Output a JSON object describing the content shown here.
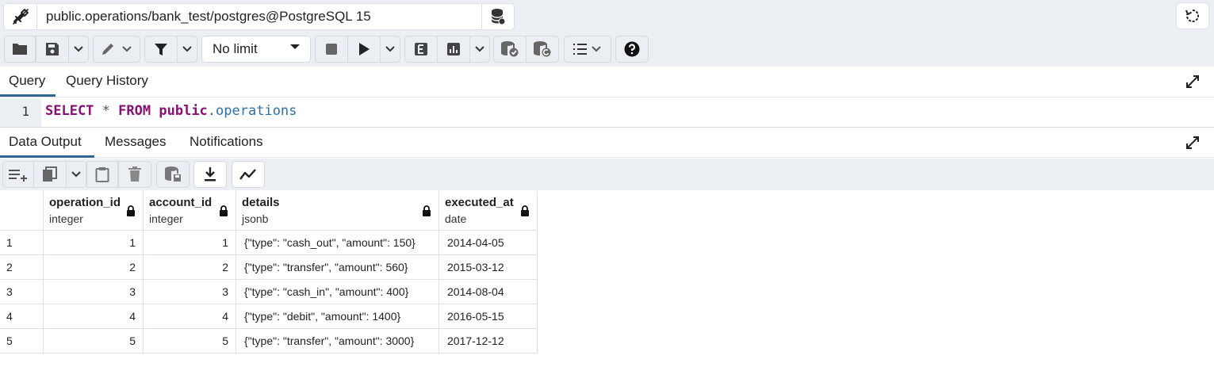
{
  "connection": {
    "title": "public.operations/bank_test/postgres@PostgreSQL 15"
  },
  "toolbar": {
    "limit_value": "No limit"
  },
  "query_tabs": [
    {
      "label": "Query",
      "active": true
    },
    {
      "label": "Query History",
      "active": false
    }
  ],
  "editor": {
    "line_number": "1",
    "tokens": {
      "select": "SELECT",
      "star": "*",
      "from": "FROM",
      "schema": "public",
      "dot": ".",
      "table": "operations"
    }
  },
  "result_tabs": [
    {
      "label": "Data Output",
      "active": true
    },
    {
      "label": "Messages",
      "active": false
    },
    {
      "label": "Notifications",
      "active": false
    }
  ],
  "columns": [
    {
      "name": "operation_id",
      "type": "integer"
    },
    {
      "name": "account_id",
      "type": "integer"
    },
    {
      "name": "details",
      "type": "jsonb"
    },
    {
      "name": "executed_at",
      "type": "date"
    }
  ],
  "rows": [
    {
      "n": "1",
      "cells": [
        "1",
        "1",
        "{\"type\": \"cash_out\", \"amount\": 150}",
        "2014-04-05"
      ]
    },
    {
      "n": "2",
      "cells": [
        "2",
        "2",
        "{\"type\": \"transfer\", \"amount\": 560}",
        "2015-03-12"
      ]
    },
    {
      "n": "3",
      "cells": [
        "3",
        "3",
        "{\"type\": \"cash_in\", \"amount\": 400}",
        "2014-08-04"
      ]
    },
    {
      "n": "4",
      "cells": [
        "4",
        "4",
        "{\"type\": \"debit\", \"amount\": 1400}",
        "2016-05-15"
      ]
    },
    {
      "n": "5",
      "cells": [
        "5",
        "5",
        "{\"type\": \"transfer\", \"amount\": 3000}",
        "2017-12-12"
      ]
    }
  ],
  "icons": {
    "connection_status": "plug-disconnected-icon",
    "database": "database-icon",
    "refresh": "refresh-icon",
    "open_file": "folder-icon",
    "save": "save-icon",
    "edit": "pencil-icon",
    "filter": "filter-icon",
    "stop": "stop-icon",
    "execute": "play-icon",
    "explain": "explain-icon",
    "explain_analyze": "chart-icon",
    "commit": "commit-icon",
    "rollback": "rollback-icon",
    "macros": "list-icon",
    "help": "help-icon",
    "expand": "expand-icon",
    "add_row": "add-row-icon",
    "copy": "copy-icon",
    "paste": "paste-icon",
    "delete": "trash-icon",
    "save_data": "save-data-icon",
    "download": "download-icon",
    "graph": "graph-icon",
    "lock": "lock-icon"
  },
  "colors": {
    "toolbar_bg": "#ebeef3",
    "active_tab": "#326690",
    "keyword": "#8a0f73",
    "identifier": "#2f6ea8"
  }
}
